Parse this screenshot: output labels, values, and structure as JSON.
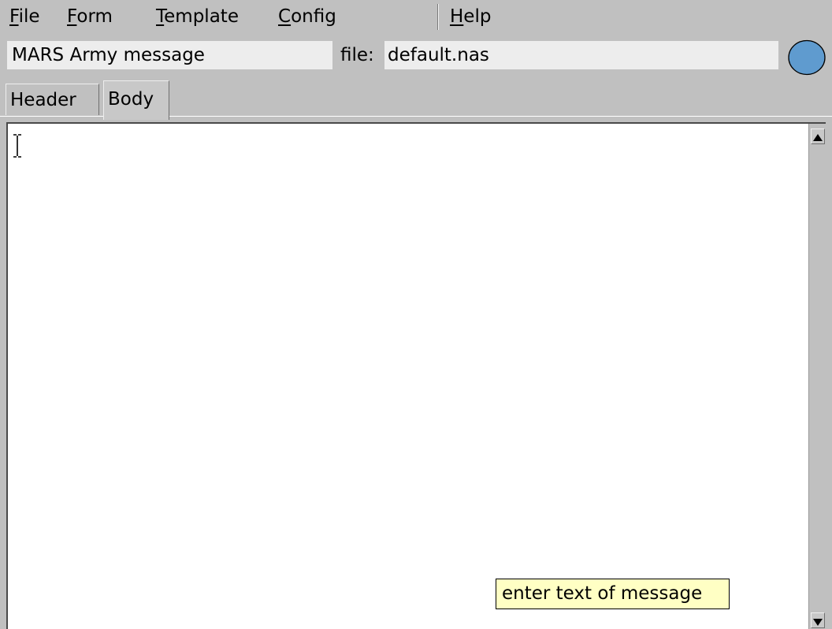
{
  "menubar": {
    "items": [
      {
        "accel": "F",
        "rest": "ile"
      },
      {
        "accel": "F",
        "rest": "orm"
      },
      {
        "accel": "T",
        "rest": "emplate"
      },
      {
        "accel": "C",
        "rest": "onfig"
      },
      {
        "accel": "H",
        "rest": "elp"
      }
    ]
  },
  "header_row": {
    "title_value": "MARS Army message",
    "file_label": "file:",
    "file_value": "default.nas",
    "status_color": "#5f9bcf"
  },
  "tabs": [
    {
      "label": "Header",
      "selected": false
    },
    {
      "label": "Body",
      "selected": true
    }
  ],
  "body_editor": {
    "value": "",
    "tooltip": "enter text of message"
  },
  "colors": {
    "window_bg": "#c0c0c0",
    "field_bg": "#ededed",
    "editor_bg": "#ffffff",
    "tooltip_bg": "#ffffc4"
  }
}
